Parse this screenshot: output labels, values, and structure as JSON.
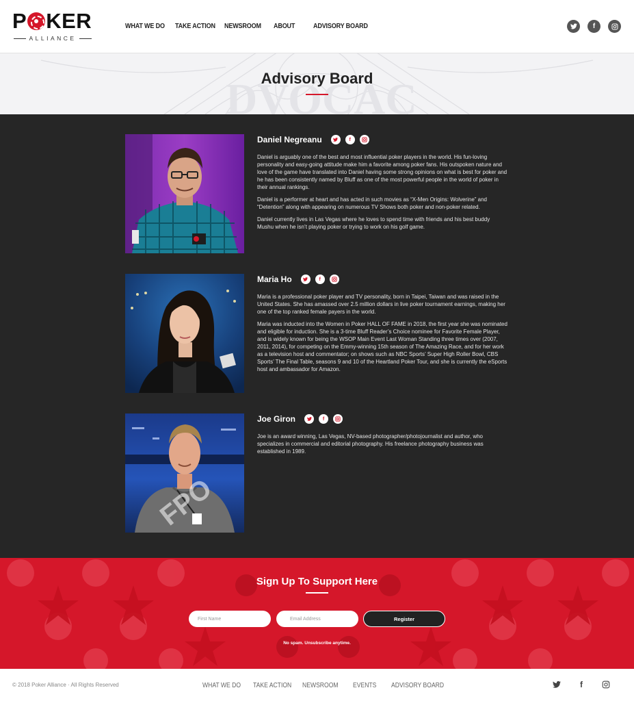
{
  "brand": {
    "name_left": "P",
    "name_right": "KER",
    "sub": "ALLIANCE"
  },
  "nav": [
    "WHAT WE DO",
    "TAKE ACTION",
    "NEWSROOM",
    "ABOUT",
    "ADVISORY BOARD"
  ],
  "header_social": [
    "twitter-icon",
    "facebook-icon",
    "instagram-icon"
  ],
  "hero": {
    "title": "Advisory Board"
  },
  "members": [
    {
      "name": "Daniel Negreanu",
      "bio": [
        "Daniel is arguably one of the best and most influential poker players in the world. His fun-loving personality and easy-going attitude make him a favorite among poker fans. His outspoken nature and love of the game have translated into Daniel having some strong opinions on what is best for poker and he has been consistently named by Bluff as one of the most powerful people in the world of poker in their annual rankings.",
        "Daniel is a performer at heart and has acted in such movies as “X-Men Origins: Wolverine” and “Detention” along with appearing on numerous TV Shows both poker and non-poker related.",
        "Daniel currently lives in Las Vegas where he loves to spend time with friends and his best buddy Mushu when he isn’t playing poker or trying to work on his golf game."
      ]
    },
    {
      "name": "Maria Ho",
      "bio": [
        "Maria is a professional poker player and TV personality, born in Taipei, Taiwan and was raised in the United States. She has amassed over 2.5 million dollars in live poker tournament earnings, making her one of the top ranked female payers in the world.",
        "Maria was inducted into the Women in Poker HALL OF FAME in 2018, the first year she was nominated and eligible for induction. She is a 3-time Bluff Reader’s Choice nominee for Favorite Female Player, and is widely known for being the WSOP Main Event Last Woman Standing three times over (2007, 2011, 2014), for competing on the Emmy-winning 15th season of The Amazing Race, and for her work as a television host and commentator; on shows such as NBC Sports’ Super High Roller Bowl, CBS Sports’ The Final Table, seasons 9 and 10 of the Heartland Poker Tour, and she is currently the eSports host and ambassador for Amazon."
      ]
    },
    {
      "name": "Joe Giron",
      "photo_overlay": "FPO",
      "bio": [
        "Joe is an award winning, Las Vegas, NV-based photographer/photojournalist and author, who specializes in commercial and editorial photography. His freelance photography business was established in 1989."
      ]
    }
  ],
  "signup": {
    "title": "Sign Up To Support Here",
    "first_name_placeholder": "First Name",
    "email_placeholder": "Email Address",
    "register_label": "Register",
    "note": "No spam. Unsubscribe anytime."
  },
  "footer": {
    "copyright": "© 2018 Poker Alliance · All Rights Reserved",
    "nav": [
      "WHAT WE DO",
      "TAKE ACTION",
      "NEWSROOM",
      "EVENTS",
      "ADVISORY BOARD"
    ],
    "social": [
      "twitter-icon",
      "facebook-icon",
      "instagram-icon"
    ]
  },
  "colors": {
    "accent": "#d5172a",
    "dark": "#262626"
  }
}
